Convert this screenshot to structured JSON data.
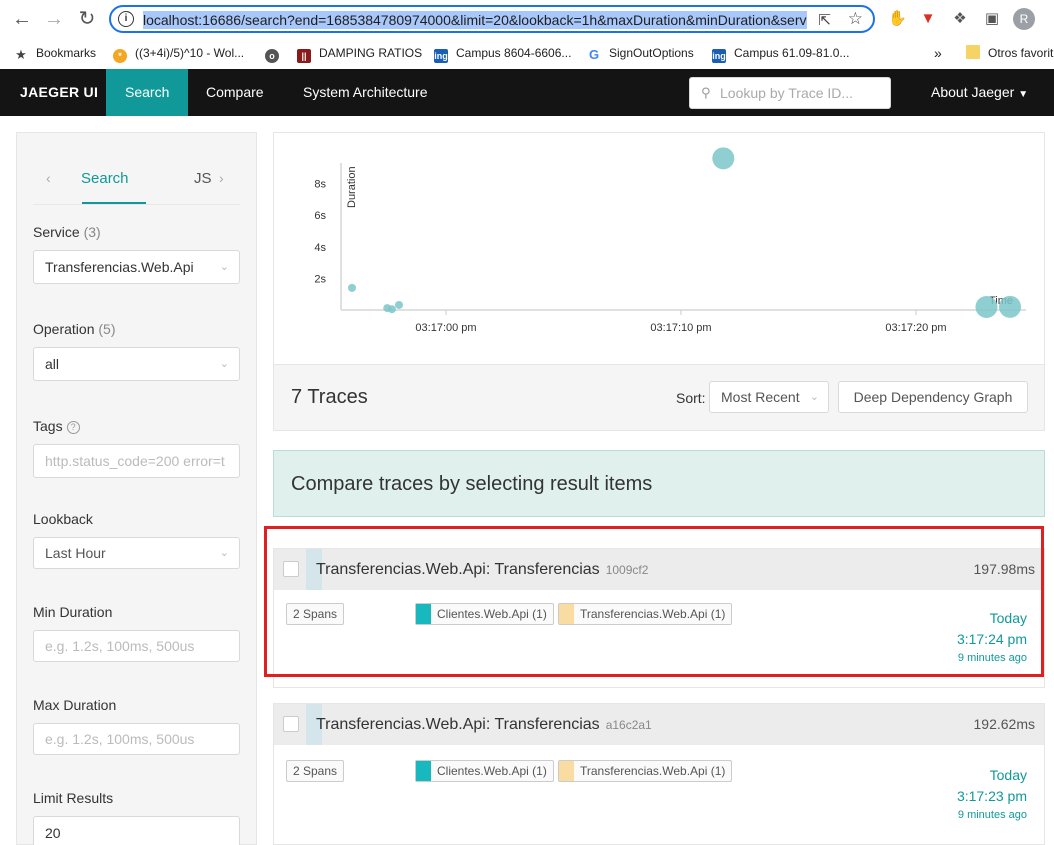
{
  "browser": {
    "url": "localhost:16686/search?end=1685384780974000&limit=20&lookback=1h&maxDuration&minDuration&service=Transferencias.Web.Api",
    "profile_initial": "R"
  },
  "bookmarks": {
    "items": [
      {
        "label": "Bookmarks"
      },
      {
        "label": "((3+4i)/5)^10 - Wol..."
      },
      {
        "label": ""
      },
      {
        "label": "DAMPING RATIOS"
      },
      {
        "label": "Campus 8604-6606..."
      },
      {
        "label": "SignOutOptions"
      },
      {
        "label": "Campus 61.09-81.0..."
      }
    ],
    "overflow": "»",
    "other": "Otros favorit"
  },
  "topnav": {
    "brand": "JAEGER UI",
    "items": [
      "Search",
      "Compare",
      "System Architecture"
    ],
    "lookup_placeholder": "Lookup by Trace ID...",
    "about": "About Jaeger"
  },
  "left": {
    "tab_search": "Search",
    "tab_json": "JS",
    "service_label": "Service",
    "service_count": "(3)",
    "service_value": "Transferencias.Web.Api",
    "operation_label": "Operation",
    "operation_count": "(5)",
    "operation_value": "all",
    "tags_label": "Tags",
    "tags_placeholder": "http.status_code=200 error=t",
    "lookback_label": "Lookback",
    "lookback_value": "Last Hour",
    "min_label": "Min Duration",
    "min_placeholder": "e.g. 1.2s, 100ms, 500us",
    "max_label": "Max Duration",
    "max_placeholder": "e.g. 1.2s, 100ms, 500us",
    "limit_label": "Limit Results",
    "limit_value": "20"
  },
  "chart_data": {
    "type": "scatter",
    "ylabel": "Duration",
    "xlabel": "Time",
    "y_ticks": [
      "2s",
      "4s",
      "6s",
      "8s"
    ],
    "x_ticks": [
      "03:17:00 pm",
      "03:17:10 pm",
      "03:17:20 pm"
    ],
    "ylim": [
      0,
      10
    ],
    "points": [
      {
        "t": "03:16:56 pm",
        "duration_s": 1.4,
        "size": "small"
      },
      {
        "t": "03:16:57.5 pm",
        "duration_s": 0.12,
        "size": "small"
      },
      {
        "t": "03:16:57.7 pm",
        "duration_s": 0.05,
        "size": "small"
      },
      {
        "t": "03:16:58 pm",
        "duration_s": 0.32,
        "size": "small"
      },
      {
        "t": "03:17:11.8 pm",
        "duration_s": 9.6,
        "size": "large"
      },
      {
        "t": "03:17:23 pm",
        "duration_s": 0.19,
        "size": "large"
      },
      {
        "t": "03:17:24 pm",
        "duration_s": 0.2,
        "size": "large"
      }
    ]
  },
  "results": {
    "count_label": "7 Traces",
    "sort_label": "Sort:",
    "sort_value": "Most Recent",
    "ddg_label": "Deep Dependency Graph",
    "compare_hint": "Compare traces by selecting result items"
  },
  "traces": [
    {
      "title": "Transferencias.Web.Api: Transferencias",
      "id": "1009cf2",
      "duration": "197.98ms",
      "spans": "2 Spans",
      "services": [
        {
          "name": "Clientes.Web.Api (1)",
          "color": "#17b8be"
        },
        {
          "name": "Transferencias.Web.Api (1)",
          "color": "#f8dcA1"
        }
      ],
      "date": "Today",
      "time": "3:17:24 pm",
      "ago": "9 minutes ago"
    },
    {
      "title": "Transferencias.Web.Api: Transferencias",
      "id": "a16c2a1",
      "duration": "192.62ms",
      "spans": "2 Spans",
      "services": [
        {
          "name": "Clientes.Web.Api (1)",
          "color": "#17b8be"
        },
        {
          "name": "Transferencias.Web.Api (1)",
          "color": "#f8dcA1"
        }
      ],
      "date": "Today",
      "time": "3:17:23 pm",
      "ago": "9 minutes ago"
    }
  ]
}
